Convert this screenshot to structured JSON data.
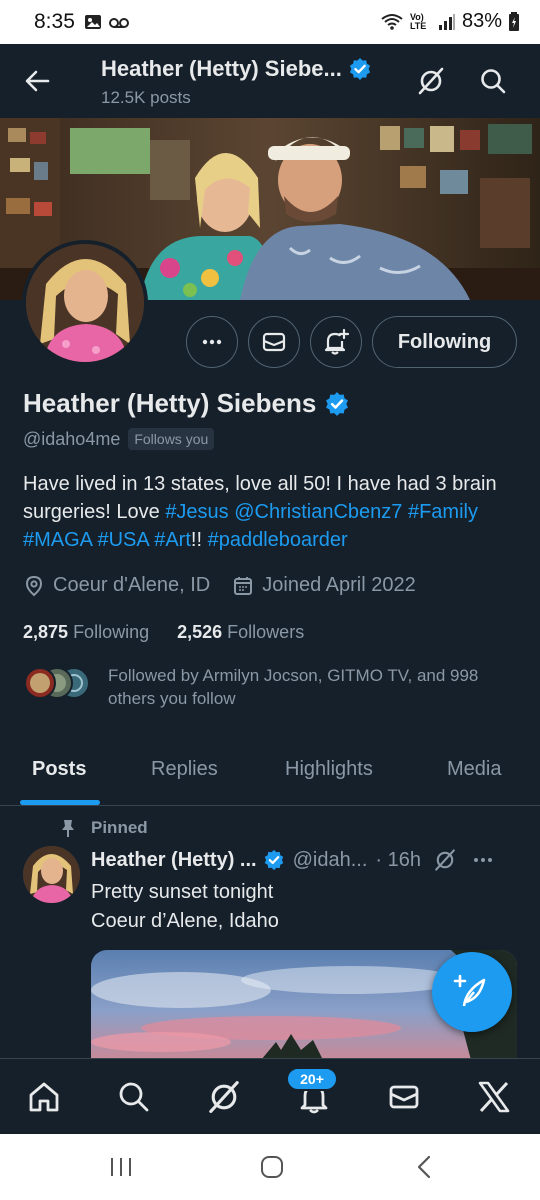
{
  "status_bar": {
    "time": "8:35",
    "network_label": "Vo) LTE",
    "battery": "83%"
  },
  "header": {
    "name": "Heather (Hetty) Siebe...",
    "posts_count": "12.5K posts"
  },
  "profile": {
    "display_name": "Heather (Hetty) Siebens",
    "handle": "@idaho4me",
    "follows_you": "Follows you",
    "bio_text": "Have lived in 13 states, love all 50! I have had 3 brain surgeries! Love",
    "bio_jesus": "#Jesus",
    "bio_mention": "@ChristianCbenz7",
    "bio_family": "#Family",
    "bio_maga": "#MAGA",
    "bio_usa": "#USA",
    "bio_art": "#Art",
    "bio_excl": "!!",
    "bio_paddle": "#paddleboarder",
    "location": "Coeur d'Alene, ID",
    "joined": "Joined April 2022",
    "following_count": "2,875",
    "following_label": "Following",
    "followers_count": "2,526",
    "followers_label": "Followers",
    "followed_by": "Followed by Armilyn Jocson, GITMO TV, and 998 others you follow",
    "following_button": "Following"
  },
  "tabs": [
    {
      "label": "Posts",
      "active": true
    },
    {
      "label": "Replies",
      "active": false
    },
    {
      "label": "Highlights",
      "active": false
    },
    {
      "label": "Media",
      "active": false
    }
  ],
  "pinned_post": {
    "pinned_label": "Pinned",
    "author_name": "Heather (Hetty) ...",
    "author_handle": "@idah...",
    "time": "· 16h",
    "text_line1": "Pretty sunset tonight",
    "text_line2": "Coeur d’Alene, Idaho"
  },
  "bottom_nav": {
    "notification_badge": "20+"
  },
  "colors": {
    "background": "#15202b",
    "accent": "#1d9bf0",
    "secondary_text": "#8b98a5",
    "border": "#536471"
  }
}
